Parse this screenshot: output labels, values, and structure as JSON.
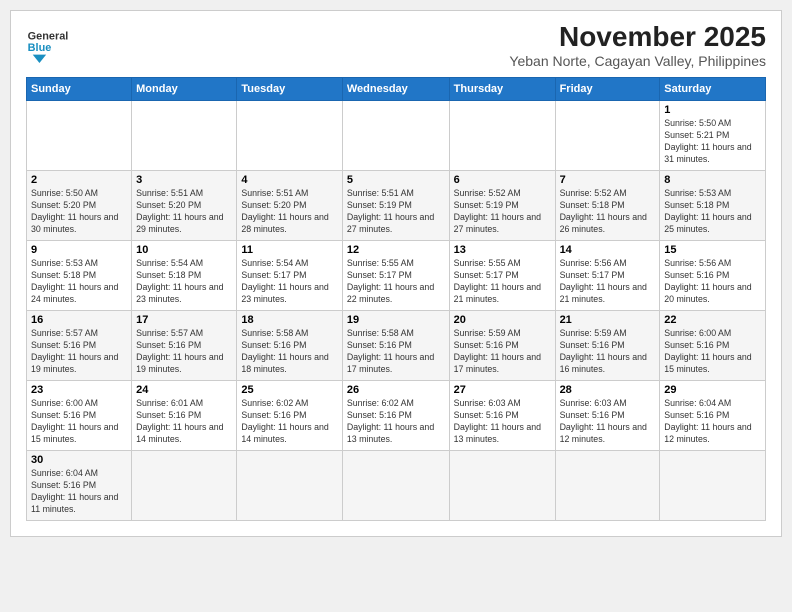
{
  "logo": {
    "text_general": "General",
    "text_blue": "Blue"
  },
  "header": {
    "month": "November 2025",
    "location": "Yeban Norte, Cagayan Valley, Philippines"
  },
  "days_of_week": [
    "Sunday",
    "Monday",
    "Tuesday",
    "Wednesday",
    "Thursday",
    "Friday",
    "Saturday"
  ],
  "weeks": [
    [
      {
        "day": "",
        "info": ""
      },
      {
        "day": "",
        "info": ""
      },
      {
        "day": "",
        "info": ""
      },
      {
        "day": "",
        "info": ""
      },
      {
        "day": "",
        "info": ""
      },
      {
        "day": "",
        "info": ""
      },
      {
        "day": "1",
        "info": "Sunrise: 5:50 AM\nSunset: 5:21 PM\nDaylight: 11 hours and 31 minutes."
      }
    ],
    [
      {
        "day": "2",
        "info": "Sunrise: 5:50 AM\nSunset: 5:20 PM\nDaylight: 11 hours and 30 minutes."
      },
      {
        "day": "3",
        "info": "Sunrise: 5:51 AM\nSunset: 5:20 PM\nDaylight: 11 hours and 29 minutes."
      },
      {
        "day": "4",
        "info": "Sunrise: 5:51 AM\nSunset: 5:20 PM\nDaylight: 11 hours and 28 minutes."
      },
      {
        "day": "5",
        "info": "Sunrise: 5:51 AM\nSunset: 5:19 PM\nDaylight: 11 hours and 27 minutes."
      },
      {
        "day": "6",
        "info": "Sunrise: 5:52 AM\nSunset: 5:19 PM\nDaylight: 11 hours and 27 minutes."
      },
      {
        "day": "7",
        "info": "Sunrise: 5:52 AM\nSunset: 5:18 PM\nDaylight: 11 hours and 26 minutes."
      },
      {
        "day": "8",
        "info": "Sunrise: 5:53 AM\nSunset: 5:18 PM\nDaylight: 11 hours and 25 minutes."
      }
    ],
    [
      {
        "day": "9",
        "info": "Sunrise: 5:53 AM\nSunset: 5:18 PM\nDaylight: 11 hours and 24 minutes."
      },
      {
        "day": "10",
        "info": "Sunrise: 5:54 AM\nSunset: 5:18 PM\nDaylight: 11 hours and 23 minutes."
      },
      {
        "day": "11",
        "info": "Sunrise: 5:54 AM\nSunset: 5:17 PM\nDaylight: 11 hours and 23 minutes."
      },
      {
        "day": "12",
        "info": "Sunrise: 5:55 AM\nSunset: 5:17 PM\nDaylight: 11 hours and 22 minutes."
      },
      {
        "day": "13",
        "info": "Sunrise: 5:55 AM\nSunset: 5:17 PM\nDaylight: 11 hours and 21 minutes."
      },
      {
        "day": "14",
        "info": "Sunrise: 5:56 AM\nSunset: 5:17 PM\nDaylight: 11 hours and 21 minutes."
      },
      {
        "day": "15",
        "info": "Sunrise: 5:56 AM\nSunset: 5:16 PM\nDaylight: 11 hours and 20 minutes."
      }
    ],
    [
      {
        "day": "16",
        "info": "Sunrise: 5:57 AM\nSunset: 5:16 PM\nDaylight: 11 hours and 19 minutes."
      },
      {
        "day": "17",
        "info": "Sunrise: 5:57 AM\nSunset: 5:16 PM\nDaylight: 11 hours and 19 minutes."
      },
      {
        "day": "18",
        "info": "Sunrise: 5:58 AM\nSunset: 5:16 PM\nDaylight: 11 hours and 18 minutes."
      },
      {
        "day": "19",
        "info": "Sunrise: 5:58 AM\nSunset: 5:16 PM\nDaylight: 11 hours and 17 minutes."
      },
      {
        "day": "20",
        "info": "Sunrise: 5:59 AM\nSunset: 5:16 PM\nDaylight: 11 hours and 17 minutes."
      },
      {
        "day": "21",
        "info": "Sunrise: 5:59 AM\nSunset: 5:16 PM\nDaylight: 11 hours and 16 minutes."
      },
      {
        "day": "22",
        "info": "Sunrise: 6:00 AM\nSunset: 5:16 PM\nDaylight: 11 hours and 15 minutes."
      }
    ],
    [
      {
        "day": "23",
        "info": "Sunrise: 6:00 AM\nSunset: 5:16 PM\nDaylight: 11 hours and 15 minutes."
      },
      {
        "day": "24",
        "info": "Sunrise: 6:01 AM\nSunset: 5:16 PM\nDaylight: 11 hours and 14 minutes."
      },
      {
        "day": "25",
        "info": "Sunrise: 6:02 AM\nSunset: 5:16 PM\nDaylight: 11 hours and 14 minutes."
      },
      {
        "day": "26",
        "info": "Sunrise: 6:02 AM\nSunset: 5:16 PM\nDaylight: 11 hours and 13 minutes."
      },
      {
        "day": "27",
        "info": "Sunrise: 6:03 AM\nSunset: 5:16 PM\nDaylight: 11 hours and 13 minutes."
      },
      {
        "day": "28",
        "info": "Sunrise: 6:03 AM\nSunset: 5:16 PM\nDaylight: 11 hours and 12 minutes."
      },
      {
        "day": "29",
        "info": "Sunrise: 6:04 AM\nSunset: 5:16 PM\nDaylight: 11 hours and 12 minutes."
      }
    ],
    [
      {
        "day": "30",
        "info": "Sunrise: 6:04 AM\nSunset: 5:16 PM\nDaylight: 11 hours and 11 minutes."
      },
      {
        "day": "",
        "info": ""
      },
      {
        "day": "",
        "info": ""
      },
      {
        "day": "",
        "info": ""
      },
      {
        "day": "",
        "info": ""
      },
      {
        "day": "",
        "info": ""
      },
      {
        "day": "",
        "info": ""
      }
    ]
  ]
}
